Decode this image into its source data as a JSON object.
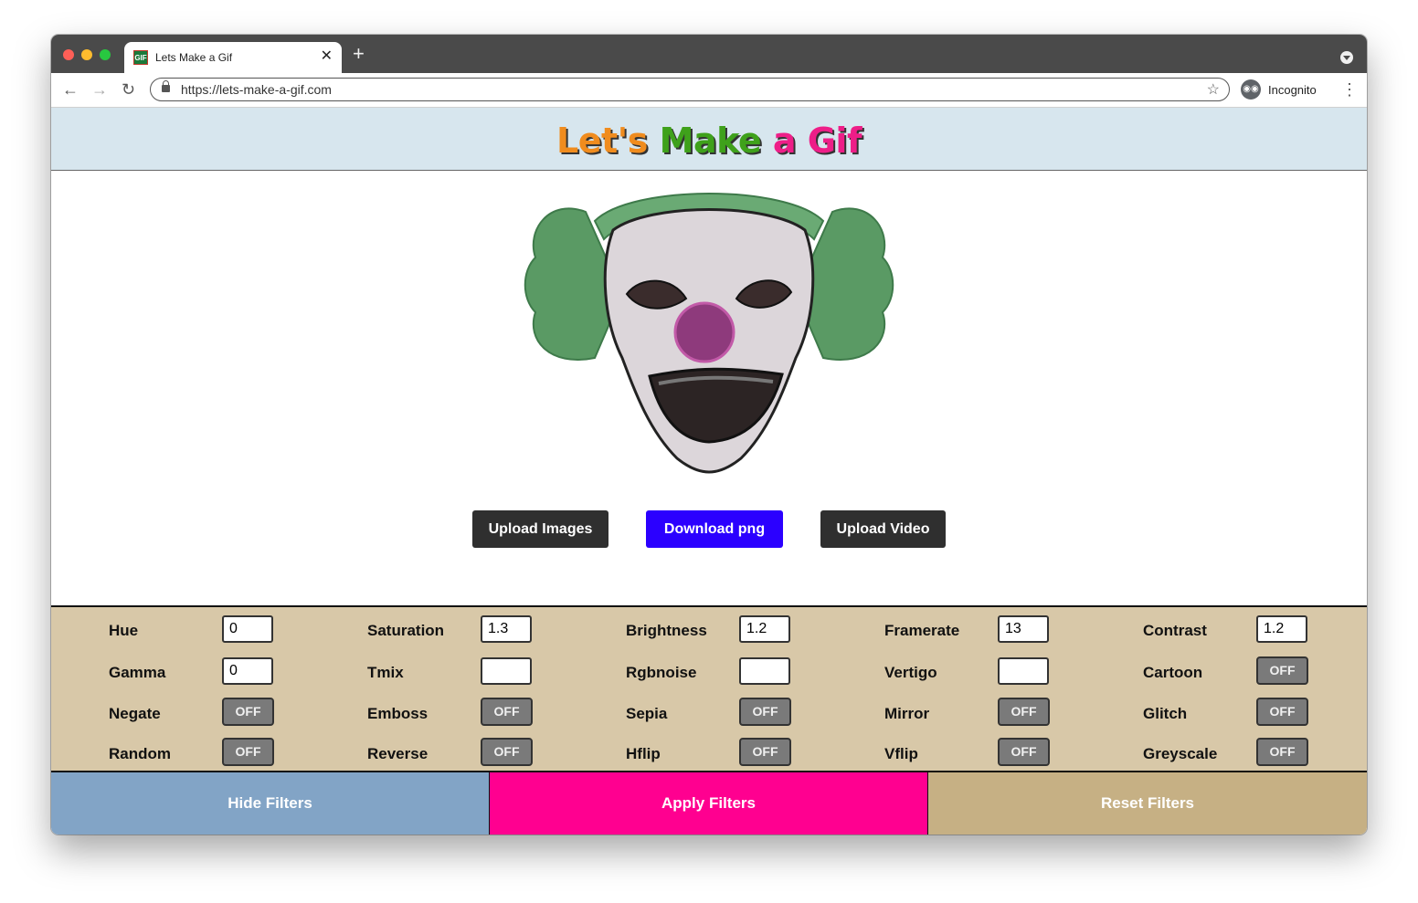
{
  "browser": {
    "tab_title": "Lets Make a Gif",
    "favicon_text": "GIF",
    "new_tab": "+",
    "close_tab": "✕",
    "url": "https://lets-make-a-gif.com",
    "incognito_label": "Incognito"
  },
  "header": {
    "logo_part1": "Let's",
    "logo_part2": "Make",
    "logo_part3": "a Gif"
  },
  "buttons": {
    "upload_images": "Upload Images",
    "download_png": "Download png",
    "upload_video": "Upload Video"
  },
  "filters": {
    "rows": [
      [
        {
          "label": "Hue",
          "type": "input",
          "value": "0"
        },
        {
          "label": "Saturation",
          "type": "input",
          "value": "1.3"
        },
        {
          "label": "Brightness",
          "type": "input",
          "value": "1.2"
        },
        {
          "label": "Framerate",
          "type": "input",
          "value": "13"
        },
        {
          "label": "Contrast",
          "type": "input",
          "value": "1.2"
        }
      ],
      [
        {
          "label": "Gamma",
          "type": "input",
          "value": "0"
        },
        {
          "label": "Tmix",
          "type": "input",
          "value": ""
        },
        {
          "label": "Rgbnoise",
          "type": "input",
          "value": ""
        },
        {
          "label": "Vertigo",
          "type": "input",
          "value": ""
        },
        {
          "label": "Cartoon",
          "type": "toggle",
          "value": "OFF"
        }
      ],
      [
        {
          "label": "Negate",
          "type": "toggle",
          "value": "OFF"
        },
        {
          "label": "Emboss",
          "type": "toggle",
          "value": "OFF"
        },
        {
          "label": "Sepia",
          "type": "toggle",
          "value": "OFF"
        },
        {
          "label": "Mirror",
          "type": "toggle",
          "value": "OFF"
        },
        {
          "label": "Glitch",
          "type": "toggle",
          "value": "OFF"
        }
      ],
      [
        {
          "label": "Random",
          "type": "toggle",
          "value": "OFF"
        },
        {
          "label": "Reverse",
          "type": "toggle",
          "value": "OFF"
        },
        {
          "label": "Hflip",
          "type": "toggle",
          "value": "OFF"
        },
        {
          "label": "Vflip",
          "type": "toggle",
          "value": "OFF"
        },
        {
          "label": "Greyscale",
          "type": "toggle",
          "value": "OFF"
        }
      ]
    ]
  },
  "actions": {
    "hide": "Hide Filters",
    "apply": "Apply Filters",
    "reset": "Reset Filters"
  },
  "colors": {
    "header_bg": "#d7e6ee",
    "download_button": "#2b00ff",
    "filters_bg": "#d8c8a8",
    "hide_bg": "#82a4c6",
    "apply_bg": "#ff0090",
    "reset_bg": "#c6b084"
  }
}
